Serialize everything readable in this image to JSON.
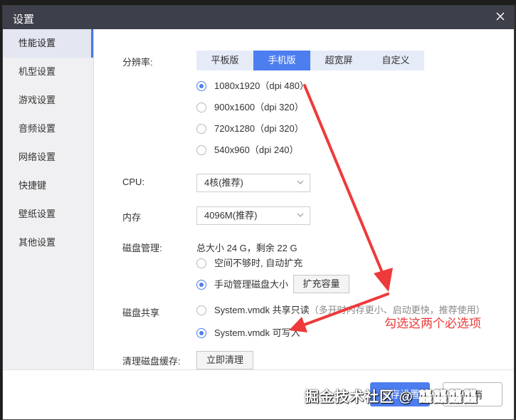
{
  "window": {
    "title": "设置"
  },
  "sidebar": {
    "items": [
      {
        "label": "性能设置",
        "active": true
      },
      {
        "label": "机型设置",
        "active": false
      },
      {
        "label": "游戏设置",
        "active": false
      },
      {
        "label": "音频设置",
        "active": false
      },
      {
        "label": "网络设置",
        "active": false
      },
      {
        "label": "快捷键",
        "active": false
      },
      {
        "label": "壁纸设置",
        "active": false
      },
      {
        "label": "其他设置",
        "active": false
      }
    ]
  },
  "resolution": {
    "label": "分辨率:",
    "tabs": [
      "平板版",
      "手机版",
      "超宽屏",
      "自定义"
    ],
    "selected_tab": "手机版",
    "options": [
      "1080x1920（dpi 480）",
      "900x1600（dpi 320）",
      "720x1280（dpi 320）",
      "540x960（dpi 240）"
    ],
    "selected_option": "1080x1920（dpi 480）"
  },
  "cpu": {
    "label": "CPU:",
    "value": "4核(推荐)"
  },
  "memory": {
    "label": "内存",
    "value": "4096M(推荐)"
  },
  "disk": {
    "label": "磁盘管理:",
    "total": "总大小 24 G，剩余 22 G",
    "auto_expand": "空间不够时, 自动扩充",
    "manual": "手动管理磁盘大小",
    "expand_button": "扩充容量",
    "selected": "manual"
  },
  "disk_share": {
    "label": "磁盘共享",
    "readonly": "System.vmdk 共享只读",
    "readonly_hint": "（多开时内存更小、启动更快，推荐使用）",
    "writable": "System.vmdk 可写入",
    "selected": "writable"
  },
  "cache": {
    "label": "清理磁盘缓存:",
    "button": "立即清理"
  },
  "footer": {
    "save": "保存设置",
    "cancel": "取消"
  },
  "annotation": {
    "text": "勾选这两个必选项",
    "color": "#ee3a3a"
  },
  "watermark": {
    "text": "掘金技术社区 @ 龘龘龘龘"
  },
  "colors": {
    "accent": "#4d7ef0",
    "titlebar": "#3d3f4a",
    "sidebar": "#f0f0f2"
  }
}
